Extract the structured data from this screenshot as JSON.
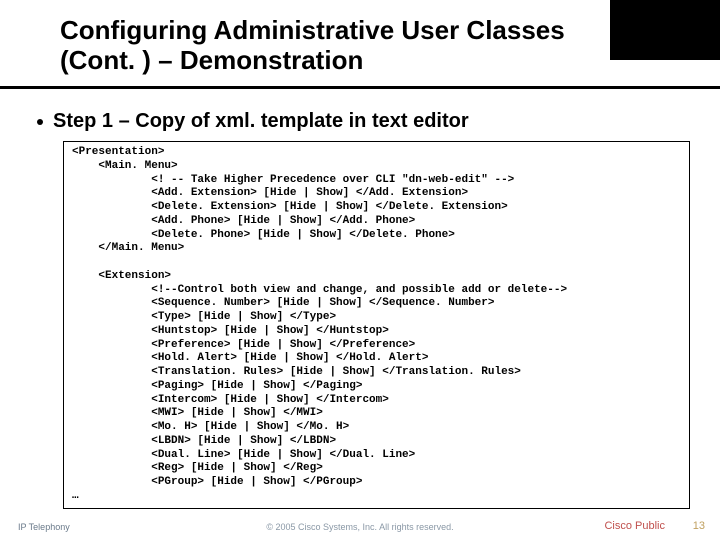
{
  "title_line1": "Configuring Administrative User Classes",
  "title_line2": "(Cont. ) – Demonstration",
  "bullet1": "Step 1 – Copy of xml. template in text editor",
  "code": "<Presentation>\n    <Main. Menu>\n            <! -- Take Higher Precedence over CLI \"dn-web-edit\" -->\n            <Add. Extension> [Hide | Show] </Add. Extension>\n            <Delete. Extension> [Hide | Show] </Delete. Extension>\n            <Add. Phone> [Hide | Show] </Add. Phone>\n            <Delete. Phone> [Hide | Show] </Delete. Phone>\n    </Main. Menu>\n\n    <Extension>\n            <!--Control both view and change, and possible add or delete-->\n            <Sequence. Number> [Hide | Show] </Sequence. Number>\n            <Type> [Hide | Show] </Type>\n            <Huntstop> [Hide | Show] </Huntstop>\n            <Preference> [Hide | Show] </Preference>\n            <Hold. Alert> [Hide | Show] </Hold. Alert>\n            <Translation. Rules> [Hide | Show] </Translation. Rules>\n            <Paging> [Hide | Show] </Paging>\n            <Intercom> [Hide | Show] </Intercom>\n            <MWI> [Hide | Show] </MWI>\n            <Mo. H> [Hide | Show] </Mo. H>\n            <LBDN> [Hide | Show] </LBDN>\n            <Dual. Line> [Hide | Show] </Dual. Line>\n            <Reg> [Hide | Show] </Reg>\n            <PGroup> [Hide | Show] </PGroup>\n…",
  "footer": {
    "left": "IP Telephony",
    "center": "© 2005 Cisco Systems, Inc. All rights reserved.",
    "public": "Cisco Public",
    "pagenum": "13"
  }
}
